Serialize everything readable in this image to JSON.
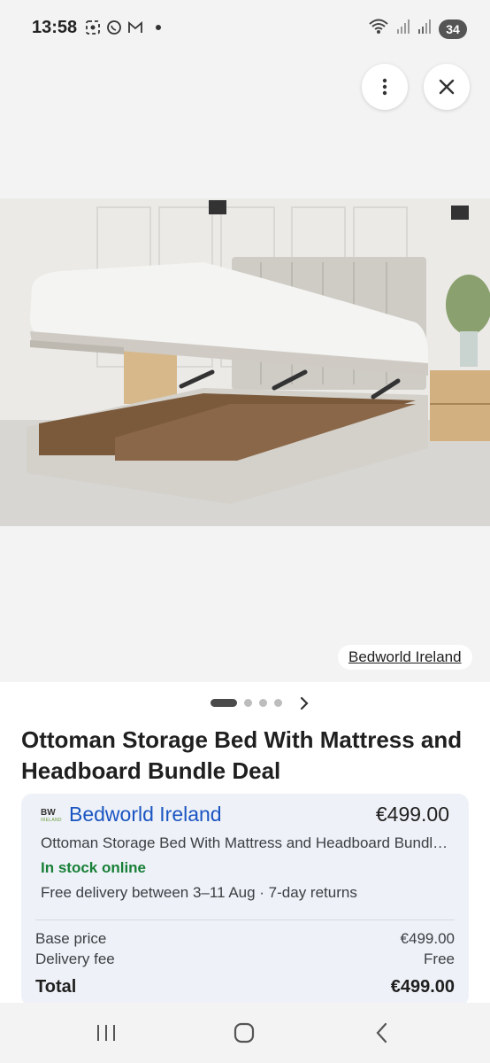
{
  "status_bar": {
    "time": "13:58",
    "battery": "34"
  },
  "image": {
    "source_label": "Bedworld Ireland"
  },
  "product": {
    "title": "Ottoman Storage Bed With Mattress and Headboard Bundle Deal"
  },
  "offer": {
    "seller_logo_text": "BW",
    "seller_logo_subtext": "IRELAND",
    "seller_name": "Bedworld Ireland",
    "price": "€499.00",
    "description": "Ottoman Storage Bed With Mattress and Headboard Bundl…",
    "stock": "In stock online",
    "delivery": "Free delivery between 3–11 Aug · 7-day returns",
    "base_price_label": "Base price",
    "base_price_value": "€499.00",
    "delivery_fee_label": "Delivery fee",
    "delivery_fee_value": "Free",
    "total_label": "Total",
    "total_value": "€499.00"
  },
  "carousel": {
    "count": 4,
    "active_index": 0
  },
  "colors": {
    "link_blue": "#1a55c2",
    "stock_green": "#188038",
    "card_bg": "#eef1f7"
  },
  "icons": [
    "more-vert-icon",
    "close-icon",
    "chevron-right-icon",
    "recents-icon",
    "home-icon",
    "back-icon"
  ]
}
